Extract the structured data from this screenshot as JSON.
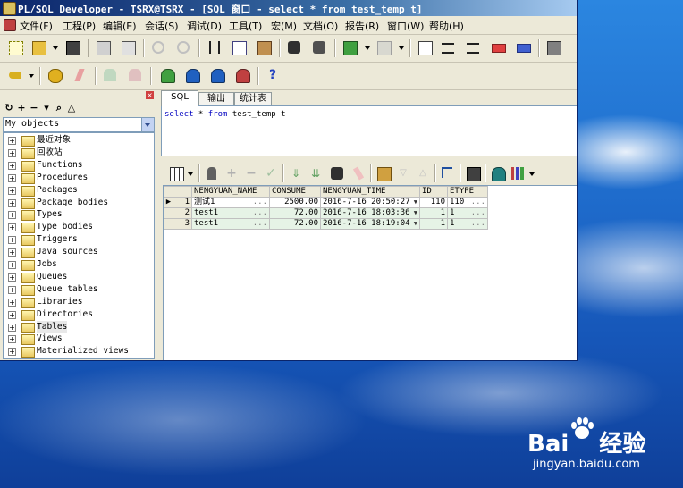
{
  "window": {
    "title": "PL/SQL Developer - TSRX@TSRX - [SQL 窗口 - select * from test_temp t]"
  },
  "menu": [
    "文件(F)",
    "工程(P)",
    "编辑(E)",
    "会话(S)",
    "调试(D)",
    "工具(T)",
    "宏(M)",
    "文档(O)",
    "报告(R)",
    "窗口(W)",
    "帮助(H)"
  ],
  "left_pane": {
    "object_selector": "My objects",
    "tree": [
      "最近对象",
      "回收站",
      "Functions",
      "Procedures",
      "Packages",
      "Package bodies",
      "Types",
      "Type bodies",
      "Triggers",
      "Java sources",
      "Jobs",
      "Queues",
      "Queue tables",
      "Libraries",
      "Directories",
      "Tables",
      "Views",
      "Materialized views"
    ],
    "selected": "Tables"
  },
  "tabs": [
    "SQL",
    "输出",
    "统计表"
  ],
  "sql_text": {
    "kw1": "select",
    "star": " * ",
    "kw2": "from",
    "rest": " test_temp t"
  },
  "grid": {
    "columns": [
      "NENGYUAN_NAME",
      "CONSUME",
      "NENGYUAN_TIME",
      "ID",
      "ETYPE"
    ],
    "rows": [
      {
        "n": "1",
        "name": "测试1",
        "consume": "2500.00",
        "time": "2016-7-16 20:50:27",
        "id": "110",
        "etype": "110"
      },
      {
        "n": "2",
        "name": "test1",
        "consume": "72.00",
        "time": "2016-7-16 18:03:36",
        "id": "1",
        "etype": "1"
      },
      {
        "n": "3",
        "name": "test1",
        "consume": "72.00",
        "time": "2016-7-16 18:19:04",
        "id": "1",
        "etype": "1"
      }
    ],
    "ellipsis": "...",
    "dropdown": "▼"
  },
  "watermark": {
    "brand_left": "Bai",
    "brand_right": "经验",
    "site": "jingyan.baidu.com"
  },
  "colors": {
    "title_start": "#0a246a",
    "title_end": "#a6caf0",
    "sql_keyword": "#0000c0",
    "row_highlight": "#e6f3e6"
  }
}
